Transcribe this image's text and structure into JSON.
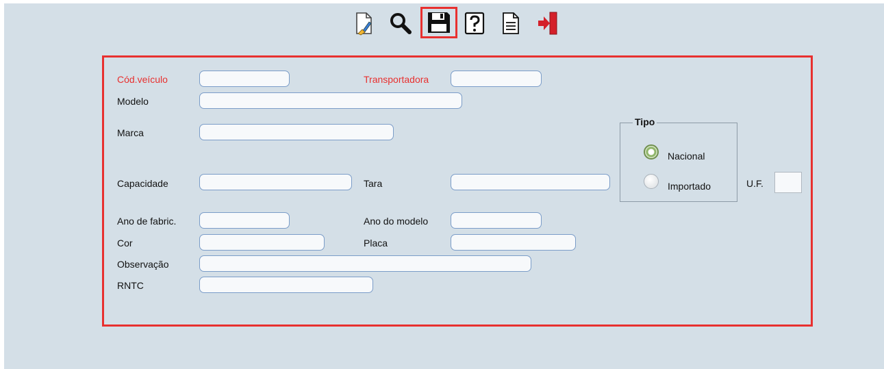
{
  "toolbar": {
    "buttons": [
      {
        "id": "new",
        "icon": "new-document-icon",
        "title": "Novo"
      },
      {
        "id": "search",
        "icon": "magnifier-icon",
        "title": "Pesquisar"
      },
      {
        "id": "save",
        "icon": "floppy-disk-icon",
        "title": "Salvar",
        "highlighted": true
      },
      {
        "id": "help",
        "icon": "help-icon",
        "title": "Ajuda"
      },
      {
        "id": "report",
        "icon": "document-lines-icon",
        "title": "Relatório"
      },
      {
        "id": "exit",
        "icon": "exit-door-icon",
        "title": "Sair"
      }
    ]
  },
  "form": {
    "cod_veiculo": {
      "label": "Cód.veículo",
      "value": ""
    },
    "transportadora": {
      "label": "Transportadora",
      "value": ""
    },
    "modelo": {
      "label": "Modelo",
      "value": ""
    },
    "marca": {
      "label": "Marca",
      "value": ""
    },
    "capacidade": {
      "label": "Capacidade",
      "value": ""
    },
    "tara": {
      "label": "Tara",
      "value": ""
    },
    "ano_fabric": {
      "label": "Ano de fabric.",
      "value": ""
    },
    "ano_modelo": {
      "label": "Ano do modelo",
      "value": ""
    },
    "cor": {
      "label": "Cor",
      "value": ""
    },
    "placa": {
      "label": "Placa",
      "value": ""
    },
    "observacao": {
      "label": "Observação",
      "value": ""
    },
    "rntc": {
      "label": "RNTC",
      "value": ""
    },
    "uf": {
      "label": "U.F.",
      "value": ""
    },
    "tipo": {
      "legend": "Tipo",
      "options": [
        {
          "label": "Nacional",
          "selected": true
        },
        {
          "label": "Importado",
          "selected": false
        }
      ]
    }
  },
  "colors": {
    "background": "#d4dfe7",
    "highlight": "#e8302f",
    "input_border": "#7a9cc8",
    "required_label": "#e8302f"
  }
}
